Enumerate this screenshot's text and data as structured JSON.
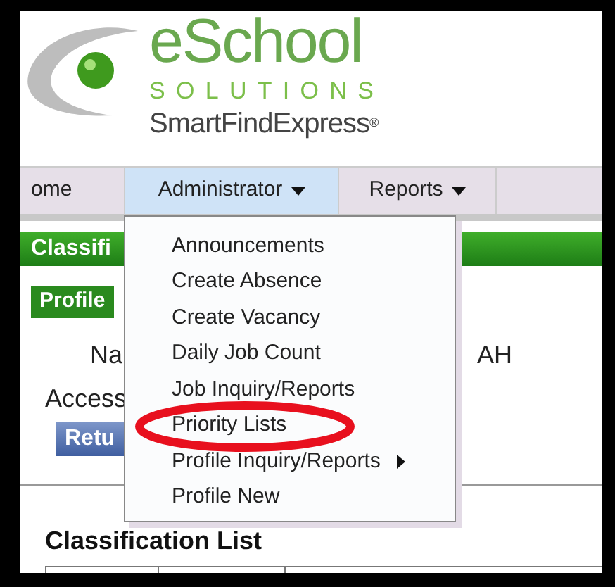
{
  "logo": {
    "name": "eSchool",
    "tagline": "SOLUTIONS",
    "product": "SmartFindExpress",
    "mark": "®"
  },
  "nav": [
    {
      "label": "ome",
      "selected": false,
      "has_menu": false
    },
    {
      "label": "Administrator",
      "selected": true,
      "has_menu": true
    },
    {
      "label": "Reports",
      "selected": false,
      "has_menu": true
    }
  ],
  "section_bar": "Classifi",
  "profile_tab": "Profile",
  "name_label": "Na",
  "name_value": "AH",
  "access_label": "Access",
  "return_button": "Retu",
  "list_title": "Classification List",
  "menu": [
    {
      "label": "Announcements",
      "submenu": false,
      "circled": false
    },
    {
      "label": "Create Absence",
      "submenu": false,
      "circled": false
    },
    {
      "label": "Create Vacancy",
      "submenu": false,
      "circled": false
    },
    {
      "label": "Daily Job Count",
      "submenu": false,
      "circled": false
    },
    {
      "label": "Job Inquiry/Reports",
      "submenu": false,
      "circled": false
    },
    {
      "label": "Priority Lists",
      "submenu": false,
      "circled": true
    },
    {
      "label": "Profile Inquiry/Reports",
      "submenu": true,
      "circled": false
    },
    {
      "label": "Profile New",
      "submenu": false,
      "circled": false
    }
  ]
}
